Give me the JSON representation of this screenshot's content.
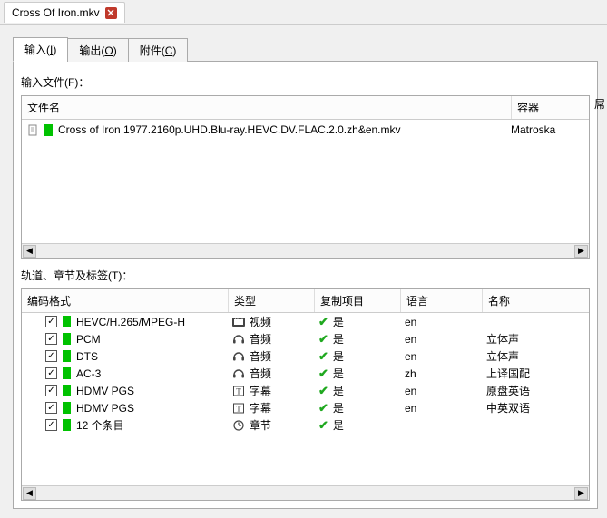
{
  "doc_tab": {
    "title": "Cross Of Iron.mkv"
  },
  "tabs": {
    "input": {
      "label": "输入",
      "hotkey": "I"
    },
    "output": {
      "label": "输出",
      "hotkey": "O"
    },
    "attachments": {
      "label": "附件",
      "hotkey": "C"
    }
  },
  "labels": {
    "input_files": "输入文件(F)：",
    "tracks": "轨道、章节及标签(T)：",
    "right_edge": "屌"
  },
  "file_columns": {
    "name": "文件名",
    "container": "容器"
  },
  "files": [
    {
      "name": "Cross of Iron 1977.2160p.UHD.Blu-ray.HEVC.DV.FLAC.2.0.zh&en.mkv",
      "container": "Matroska"
    }
  ],
  "track_columns": {
    "codec": "编码格式",
    "type": "类型",
    "copy": "复制项目",
    "lang": "语言",
    "name": "名称"
  },
  "copy_yes": "是",
  "track_types": {
    "video": "视频",
    "audio": "音频",
    "subtitle": "字幕",
    "chapter": "章节"
  },
  "tracks_list": [
    {
      "checked": true,
      "codec": "HEVC/H.265/MPEG-H",
      "type": "video",
      "copy": true,
      "lang": "en",
      "name": ""
    },
    {
      "checked": true,
      "codec": "PCM",
      "type": "audio",
      "copy": true,
      "lang": "en",
      "name": "立体声"
    },
    {
      "checked": true,
      "codec": "DTS",
      "type": "audio",
      "copy": true,
      "lang": "en",
      "name": "立体声"
    },
    {
      "checked": true,
      "codec": "AC-3",
      "type": "audio",
      "copy": true,
      "lang": "zh",
      "name": "上译国配"
    },
    {
      "checked": true,
      "codec": "HDMV PGS",
      "type": "subtitle",
      "copy": true,
      "lang": "en",
      "name": "原盘英语"
    },
    {
      "checked": true,
      "codec": "HDMV PGS",
      "type": "subtitle",
      "copy": true,
      "lang": "en",
      "name": "中英双语"
    },
    {
      "checked": true,
      "codec": "12 个条目",
      "type": "chapter",
      "copy": true,
      "lang": "",
      "name": ""
    }
  ]
}
